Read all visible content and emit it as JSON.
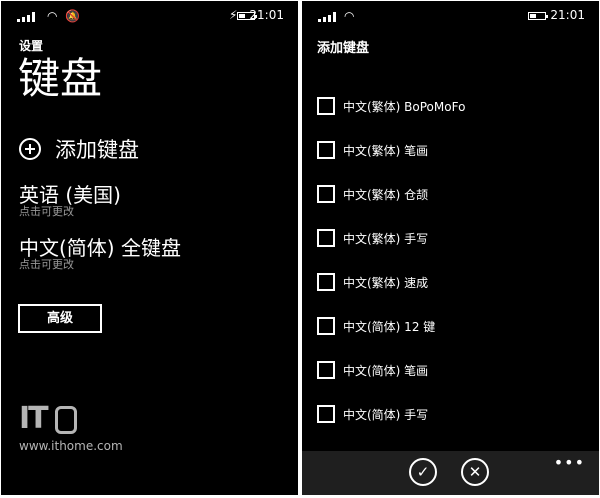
{
  "left": {
    "status": {
      "time": "21:01"
    },
    "breadcrumb": "设置",
    "title": "键盘",
    "add_keyboard": "添加键盘",
    "keyboards": [
      {
        "name": "英语 (美国)",
        "hint": "点击可更改"
      },
      {
        "name": "中文(简体) 全键盘",
        "hint": "点击可更改"
      }
    ],
    "advanced_button": "高级",
    "watermark": {
      "logo": "IT",
      "url": "www.ithome.com"
    }
  },
  "right": {
    "status": {
      "time": "21:01"
    },
    "title": "添加键盘",
    "options": [
      {
        "label": "中文(繁体) BoPoMoFo",
        "checked": false
      },
      {
        "label": "中文(繁体) 笔画",
        "checked": false
      },
      {
        "label": "中文(繁体) 仓颉",
        "checked": false
      },
      {
        "label": "中文(繁体) 手写",
        "checked": false
      },
      {
        "label": "中文(繁体) 速成",
        "checked": false
      },
      {
        "label": "中文(简体) 12 键",
        "checked": false
      },
      {
        "label": "中文(简体) 笔画",
        "checked": false
      },
      {
        "label": "中文(简体) 手写",
        "checked": false
      }
    ],
    "appbar": {
      "confirm_icon": "✓",
      "cancel_icon": "✕",
      "more": "•••"
    }
  }
}
